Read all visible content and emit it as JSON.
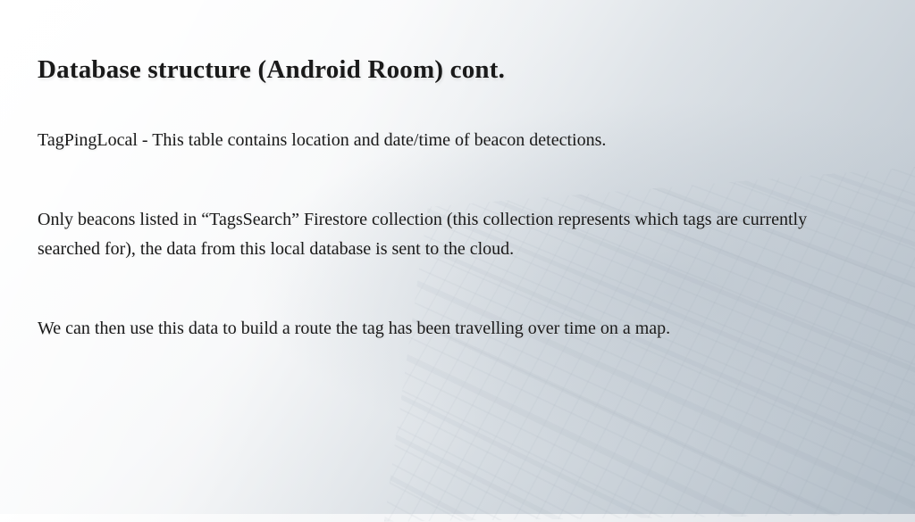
{
  "slide": {
    "title": "Database structure (Android Room) cont.",
    "paragraph1": "TagPingLocal - This table contains location and date/time of beacon detections.",
    "paragraph2": "Only beacons listed in “TagsSearch” Firestore collection (this collection represents which tags are currently searched for), the data from this local database is sent to the cloud.",
    "paragraph3": "We can then use this data to build a route the tag has been travelling over time on a map."
  }
}
